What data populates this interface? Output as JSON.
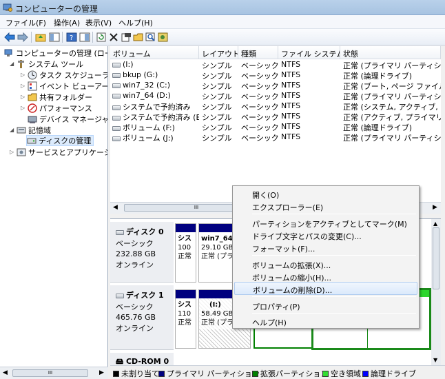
{
  "window": {
    "title": "コンピューターの管理"
  },
  "menu": [
    "ファイル(F)",
    "操作(A)",
    "表示(V)",
    "ヘルプ(H)"
  ],
  "toolbar_icons": [
    "back-arrow-icon",
    "forward-arrow-icon",
    "up-folder-icon",
    "show-hide-tree-icon",
    "help-icon",
    "properties-pane-icon",
    "refresh-icon",
    "delete-icon",
    "properties-icon",
    "open-icon",
    "search-icon",
    "settings-icon"
  ],
  "tree": {
    "root": "コンピューターの管理 (ローカ",
    "system_tools": "システム ツール",
    "task_scheduler": "タスク スケジューラ",
    "event_viewer": "イベント ビューアー",
    "shared_folders": "共有フォルダー",
    "performance": "パフォーマンス",
    "device_manager": "デバイス マネージャー",
    "storage": "記憶域",
    "disk_management": "ディスクの管理",
    "services_apps": "サービスとアプリケーショ"
  },
  "volumes": {
    "headers": [
      "ボリューム",
      "レイアウト",
      "種類",
      "ファイル システム",
      "状態"
    ],
    "rows": [
      [
        "(I:)",
        "シンプル",
        "ベーシック",
        "NTFS",
        "正常 (プライマリ パーティション"
      ],
      [
        "bkup (G:)",
        "シンプル",
        "ベーシック",
        "NTFS",
        "正常 (論理ドライブ)"
      ],
      [
        "win7_32 (C:)",
        "シンプル",
        "ベーシック",
        "NTFS",
        "正常 (ブート, ページ ファイル, ク"
      ],
      [
        "win7_64 (D:)",
        "シンプル",
        "ベーシック",
        "NTFS",
        "正常 (プライマリ パーティション"
      ],
      [
        "システムで予約済み",
        "シンプル",
        "ベーシック",
        "NTFS",
        "正常 (システム, アクティブ, プラ"
      ],
      [
        "システムで予約済み (E:)",
        "シンプル",
        "ベーシック",
        "NTFS",
        "正常 (アクティブ, プライマリ パ"
      ],
      [
        "ボリューム (F:)",
        "シンプル",
        "ベーシック",
        "NTFS",
        "正常 (論理ドライブ)"
      ],
      [
        "ボリューム (J:)",
        "シンプル",
        "ベーシック",
        "NTFS",
        "正常 (プライマリ パーティション"
      ]
    ],
    "hscroll_mark": "III"
  },
  "disks": {
    "disk0": {
      "name": "ディスク 0",
      "type": "ベーシック",
      "size": "232.88 GB",
      "status": "オンライン",
      "p1": {
        "name": "シス",
        "size": "100",
        "status": "正常"
      },
      "p2": {
        "name": "win7_64",
        "size": "29.10 GB",
        "status": "正常 (プラ"
      }
    },
    "disk1": {
      "name": "ディスク 1",
      "type": "ベーシック",
      "size": "465.76 GB",
      "status": "オンライン",
      "p1": {
        "name": "シス",
        "size": "110",
        "status": "正常"
      },
      "p2": {
        "name": "(I:)",
        "size": "58.49 GB",
        "status": "正常 (プラ"
      }
    },
    "cdrom": {
      "name": "CD-ROM 0"
    }
  },
  "context_menu": {
    "open": "開く(O)",
    "explorer": "エクスプローラー(E)",
    "mark_active": "パーティションをアクティブとしてマーク(M)",
    "change_letter": "ドライブ文字とパスの変更(C)...",
    "format": "フォーマット(F)...",
    "extend": "ボリュームの拡張(X)...",
    "shrink": "ボリュームの縮小(H)...",
    "delete": "ボリュームの削除(D)...",
    "properties": "プロパティ(P)",
    "help": "ヘルプ(H)"
  },
  "legend": [
    {
      "label": "未割り当て",
      "color": "#000000"
    },
    {
      "label": "プライマリ パーティション",
      "color": "#00007f"
    },
    {
      "label": "拡張パーティション",
      "color": "#008000"
    },
    {
      "label": "空き領域",
      "color": "#33dd33"
    },
    {
      "label": "論理ドライブ",
      "color": "#0000ff"
    }
  ],
  "tree_scroll_mark": "III"
}
